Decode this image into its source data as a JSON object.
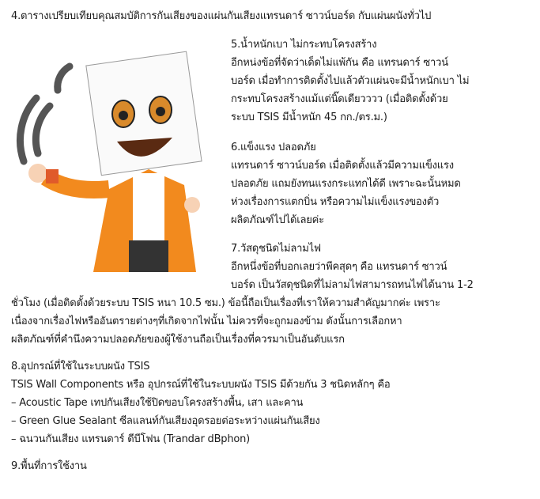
{
  "heading4": "4.ตารางเปรียบเทียบคุณสมบัติการกันเสียงของแผ่นกันเสียงแทรนดาร์ ซาวน์บอร์ด กับแผ่นผนังทั่วไป",
  "section5": {
    "title": "5.น้ำหนักเบา ไม่กระทบโครงสร้าง",
    "lines": [
      "อีกหน่งข้อที่จัดว่าเด็ดไม่แพ้กัน คือ แทรนดาร์ ซาวน์",
      "บอร์ด เมื่อทำการติดตั้งไปแล้วตัวแผ่นจะมีน้ำหนักเบา ไม่",
      "กระทบโครงสร้างแม้แต่นิ๊ดเดียวววว (เมื่อติดตั้งด้วย",
      "ระบบ TSIS มีน้ำหนัก 45 กก./ตร.ม.)"
    ]
  },
  "section6": {
    "title": "6.แข็งแรง ปลอดภัย",
    "lines": [
      "แทรนดาร์ ซาวน์บอร์ด เมื่อติดตั้งแล้วมีความแข็งแรง",
      "ปลอดภัย แถมยังทนแรงกระแทกได้ดี เพราะฉะนั้นหมด",
      "ห่วงเรื่องการแตกบิ่น หรือความไม่แข็งแรงของตัว",
      "ผลิตภัณฑ์ไปได้เลยค่ะ"
    ]
  },
  "section7": {
    "title": "7.วัสดุชนิดไม่ลามไฟ",
    "lines": [
      "อีกหนึ่งข้อที่บอกเลยว่าพีคสุดๆ คือ แทรนดาร์ ซาวน์",
      "บอร์ด เป็นวัสดุชนิดที่ไม่ลามไฟสามารถทนไฟได้นาน 1-2",
      "ชั่วโมง (เมื่อติดตั้งด้วยระบบ TSIS หนา 10.5 ซม.) ข้อนี้ถือเป็นเรื่องที่เราให้ความสำคัญมากค่ะ เพราะ",
      "เนื่องจากเรื่องไฟหรืออันตรายต่างๆที่เกิดจากไฟนั้น ไม่ควรที่จะถูกมองข้าม ดังนั้นการเลือกหา",
      "ผลิตภัณฑ์ที่คำนึงความปลอดภัยของผู้ใช้งานถือเป็นเรื่องที่ควรมาเป็นอันดับแรก"
    ]
  },
  "section8": {
    "title": "8.อุปกรณ์ที่ใช้ในระบบผนัง TSIS",
    "lines": [
      "TSIS Wall Components หรือ อุปกรณ์ที่ใช้ในระบบผนัง TSIS มีด้วยกัน 3 ชนิดหลักๆ คือ",
      "– Acoustic Tape เทปกันเสียงใช้ปิดขอบโครงสร้างพื้น, เสา และคาน",
      "– Green Glue Sealant ซีลแลนท์กันเสียงอุดรอยต่อระหว่างแผ่นกันเสียง",
      "– ฉนวนกันเสียง แทรนดาร์ ดีบีโฟน (Trandar dBphon)"
    ]
  },
  "heading9": "9.พื้นที่การใช้งาน",
  "colors": {
    "jacket": "#f28a1e",
    "text": "#1a1a1a"
  }
}
